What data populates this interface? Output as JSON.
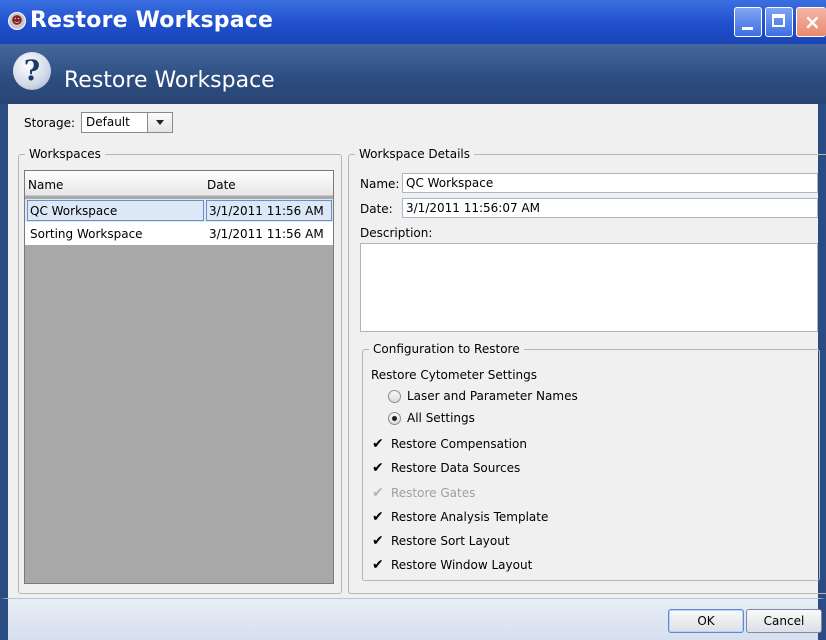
{
  "window": {
    "title": "Restore Workspace",
    "header_title": "Restore Workspace"
  },
  "storage": {
    "label": "Storage:",
    "selected": "Default"
  },
  "workspaces": {
    "group_label": "Workspaces",
    "columns": [
      "Name",
      "Date"
    ],
    "rows": [
      {
        "name": "QC Workspace",
        "date": "3/1/2011 11:56 AM",
        "selected": true
      },
      {
        "name": "Sorting Workspace",
        "date": "3/1/2011 11:56 AM",
        "selected": false
      }
    ]
  },
  "details": {
    "group_label": "Workspace Details",
    "name_label": "Name:",
    "name_value": "QC Workspace",
    "date_label": "Date:",
    "date_value": "3/1/2011 11:56:07 AM",
    "description_label": "Description:",
    "description_value": ""
  },
  "config": {
    "group_label": "Configuration to Restore",
    "cytometer_label": "Restore Cytometer Settings",
    "radio_laser": "Laser and Parameter Names",
    "radio_all": "All Settings",
    "selected_radio": "All Settings",
    "checks": [
      {
        "label": "Restore Compensation",
        "checked": true,
        "enabled": true
      },
      {
        "label": "Restore Data Sources",
        "checked": true,
        "enabled": true
      },
      {
        "label": "Restore Gates",
        "checked": true,
        "enabled": false
      },
      {
        "label": "Restore Analysis Template",
        "checked": true,
        "enabled": true
      },
      {
        "label": "Restore Sort Layout",
        "checked": true,
        "enabled": true
      },
      {
        "label": "Restore Window Layout",
        "checked": true,
        "enabled": true
      }
    ]
  },
  "buttons": {
    "ok": "OK",
    "cancel": "Cancel"
  }
}
